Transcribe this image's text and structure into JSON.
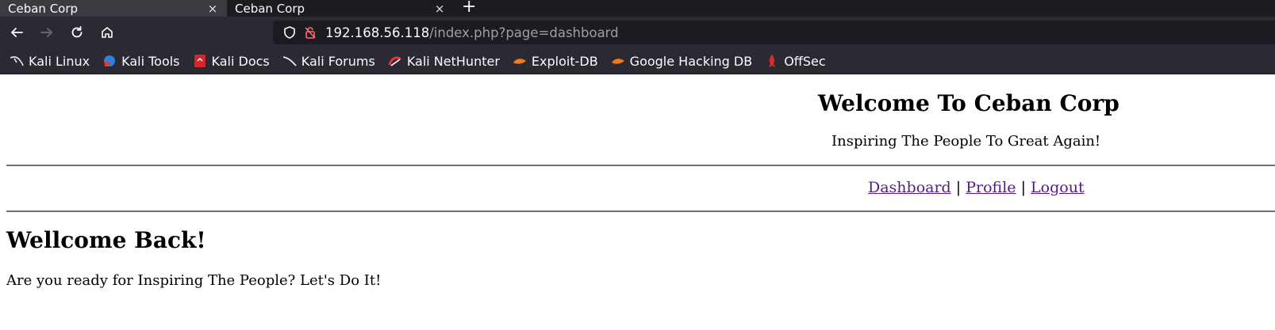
{
  "browser": {
    "tabs": [
      {
        "title": "Ceban Corp",
        "close": "×"
      },
      {
        "title": "Ceban Corp",
        "close": "×"
      }
    ],
    "new_tab_label": "+",
    "url": {
      "host": "192.168.56.118",
      "path": "/index.php?page=dashboard"
    },
    "bookmarks": [
      {
        "label": "Kali Linux",
        "icon": "kali-dragon-icon"
      },
      {
        "label": "Kali Tools",
        "icon": "kali-tools-icon"
      },
      {
        "label": "Kali Docs",
        "icon": "kali-docs-icon"
      },
      {
        "label": "Kali Forums",
        "icon": "kali-forums-icon"
      },
      {
        "label": "Kali NetHunter",
        "icon": "nethunter-icon"
      },
      {
        "label": "Exploit-DB",
        "icon": "exploit-db-icon"
      },
      {
        "label": "Google Hacking DB",
        "icon": "ghdb-icon"
      },
      {
        "label": "OffSec",
        "icon": "offsec-icon"
      }
    ],
    "colors": {
      "tabstrip": "#1c1b22",
      "toolbar": "#2b2a33",
      "visited_link": "#551a8b"
    }
  },
  "page": {
    "title": "Welcome To Ceban Corp",
    "tagline": "Inspiring The People To Great Again!",
    "nav": {
      "dashboard": "Dashboard",
      "separator": "|",
      "profile": "Profile",
      "logout": "Logout"
    },
    "heading": "Wellcome Back!",
    "message": "Are you ready for Inspiring The People? Let's Do It!"
  }
}
